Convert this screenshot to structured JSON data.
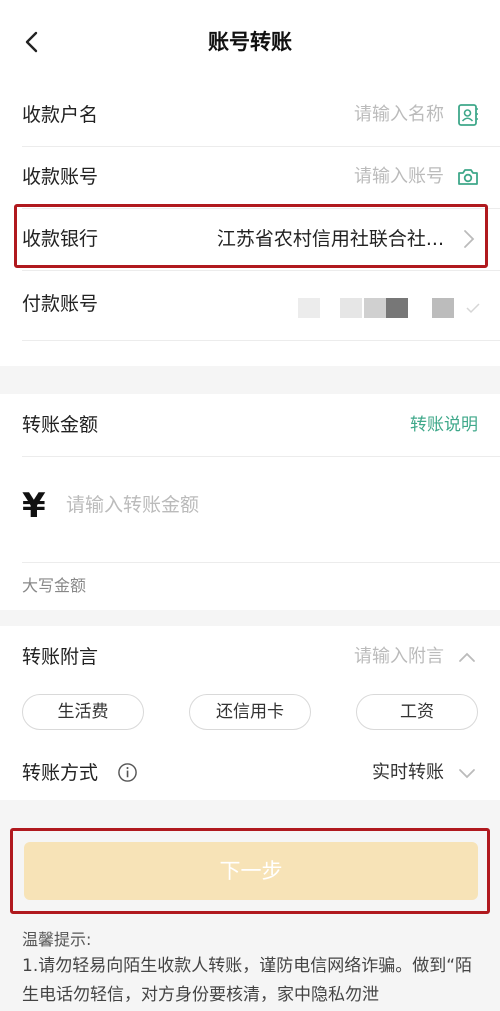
{
  "nav": {
    "title": "账号转账"
  },
  "payee": {
    "name_label": "收款户名",
    "name_placeholder": "请输入名称",
    "account_label": "收款账号",
    "account_placeholder": "请输入账号",
    "bank_label": "收款银行",
    "bank_value": "江苏省农村信用社联合社..."
  },
  "payer": {
    "label": "付款账号"
  },
  "amount": {
    "label": "转账金额",
    "help_link": "转账说明",
    "currency": "¥",
    "placeholder": "请输入转账金额",
    "uppercase_label": "大写金额"
  },
  "note": {
    "label": "转账附言",
    "placeholder": "请输入附言",
    "chips": [
      "生活费",
      "还信用卡",
      "工资"
    ]
  },
  "method": {
    "label": "转账方式",
    "value": "实时转账"
  },
  "next_button": "下一步",
  "tips": {
    "title": "温馨提示:",
    "body": "1.请勿轻易向陌生收款人转账，谨防电信网络诈骗。做到“陌生电话勿轻信，对方身份要核清，家中隐私勿泄"
  },
  "colors": {
    "accent": "#3fa88a",
    "highlight": "#b0191e",
    "button_disabled": "#f7e3b7"
  }
}
